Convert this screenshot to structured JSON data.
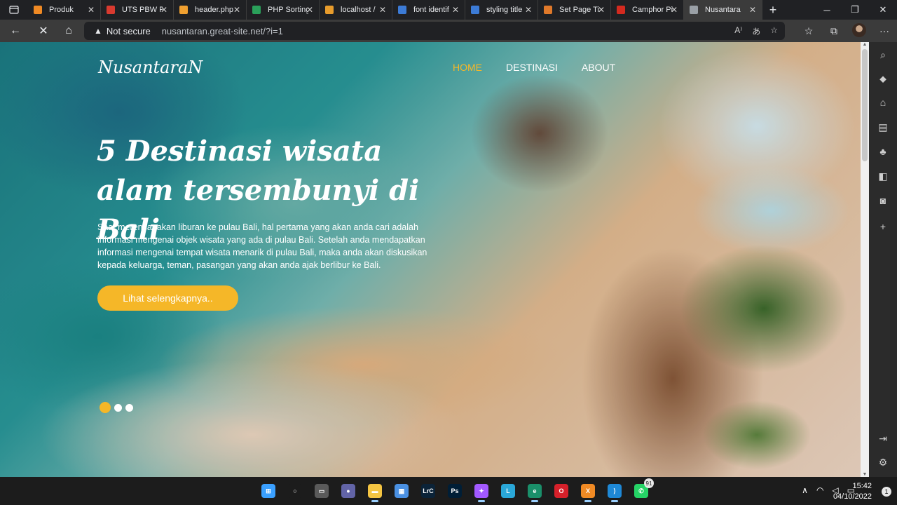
{
  "browser": {
    "tabs": [
      {
        "title": "Produk",
        "color": "#f08a24"
      },
      {
        "title": "UTS PBW Pi",
        "color": "#d93a2f"
      },
      {
        "title": "header.php",
        "color": "#f0a030"
      },
      {
        "title": "PHP Sorting",
        "color": "#2aa05a"
      },
      {
        "title": "localhost /",
        "color": "#e89c2c"
      },
      {
        "title": "font identif",
        "color": "#3c7bd6"
      },
      {
        "title": "styling title",
        "color": "#3c7bd6"
      },
      {
        "title": "Set Page Ti",
        "color": "#e0792a"
      },
      {
        "title": "Camphor Pi",
        "color": "#d42a1f"
      },
      {
        "title": "Nusantara",
        "color": "#9aa0a6"
      }
    ],
    "security_label": "Not secure",
    "url": "nusantaran.great-site.net/?i=1"
  },
  "site": {
    "logo": "NusantaraN",
    "nav": [
      {
        "label": "HOME",
        "active": true
      },
      {
        "label": "DESTINASI",
        "active": false
      },
      {
        "label": "ABOUT",
        "active": false
      }
    ],
    "hero": {
      "title": "5 Destinasi wisata alam tersembunyi di Bali",
      "text": "Saat merencanakan liburan ke pulau Bali, hal pertama yang akan anda cari adalah informasi mengenai objek wisata yang ada di pulau Bali. Setelah anda mendapatkan informasi mengenai tempat wisata menarik di pulau Bali, maka anda akan diskusikan kepada keluarga, teman, pasangan yang akan anda ajak berlibur ke Bali.",
      "cta": "Lihat selengkapnya.."
    },
    "slider_dots": 3,
    "slider_active": 1
  },
  "taskbar": {
    "apps": [
      {
        "name": "start",
        "glyph": "⊞",
        "color": "#3aa0ff"
      },
      {
        "name": "search",
        "glyph": "○",
        "color": "#1c1c1c"
      },
      {
        "name": "task-view",
        "glyph": "▭",
        "color": "#5a5a5a"
      },
      {
        "name": "teams-chat",
        "glyph": "●",
        "color": "#6264a7"
      },
      {
        "name": "file-explorer",
        "glyph": "▬",
        "color": "#f5c542"
      },
      {
        "name": "store",
        "glyph": "▦",
        "color": "#4a90e2"
      },
      {
        "name": "lightroom",
        "glyph": "LrC",
        "color": "#0b2338"
      },
      {
        "name": "photoshop",
        "glyph": "Ps",
        "color": "#001e36"
      },
      {
        "name": "figma",
        "glyph": "✦",
        "color": "#a259ff"
      },
      {
        "name": "l-app",
        "glyph": "L",
        "color": "#2aa7d8"
      },
      {
        "name": "edge",
        "glyph": "e",
        "color": "#1a8f6a"
      },
      {
        "name": "opera",
        "glyph": "O",
        "color": "#d6202a"
      },
      {
        "name": "xampp",
        "glyph": "X",
        "color": "#f08a24"
      },
      {
        "name": "vscode",
        "glyph": "⟩",
        "color": "#1e88d6"
      },
      {
        "name": "whatsapp",
        "glyph": "✆",
        "color": "#25d366"
      }
    ],
    "whatsapp_badge": "91",
    "time": "15:42",
    "date": "04/10/2022",
    "notification_count": "1"
  }
}
